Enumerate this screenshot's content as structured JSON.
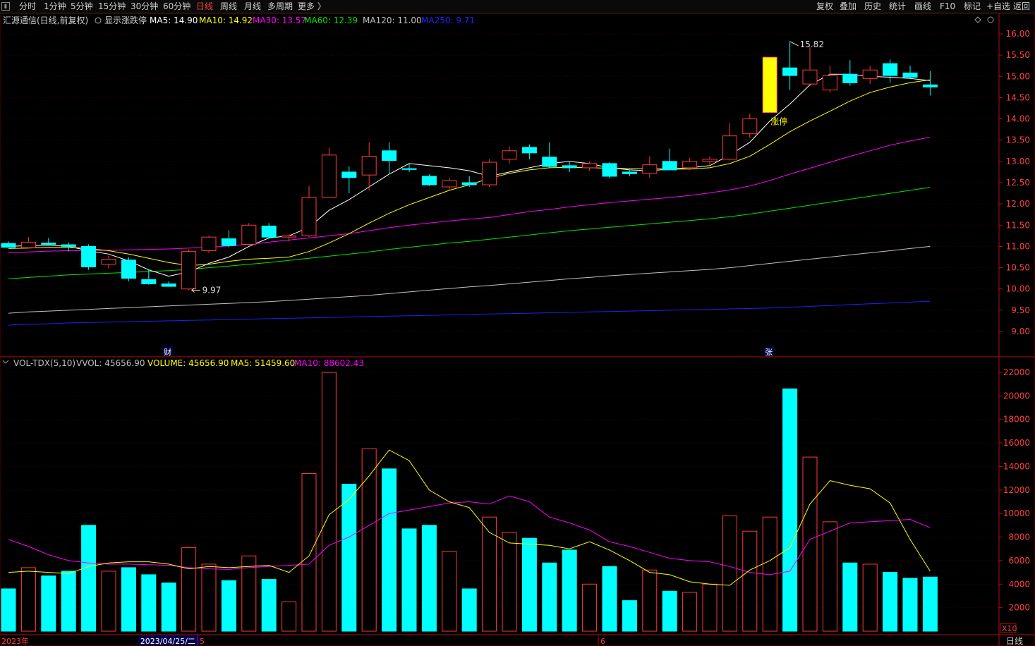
{
  "toolbar": {
    "left": [
      "分时",
      "1分钟",
      "5分钟",
      "15分钟",
      "30分钟",
      "60分钟",
      "日线",
      "周线",
      "月线",
      "多周期",
      "更多 〉"
    ],
    "active": "日线",
    "right": [
      "复权",
      "叠加",
      "历史",
      "统计",
      "画线",
      "F10",
      "标记",
      "+自选",
      "返回"
    ]
  },
  "price_header": {
    "title": "汇源通信(日线,前复权)",
    "toggle": "显示涨跌停",
    "items": [
      {
        "label": "MA5: 14.90",
        "color": "#ffffff"
      },
      {
        "label": "MA10: 14.92",
        "color": "#ffff00"
      },
      {
        "label": "MA30: 13.57",
        "color": "#ff00ff"
      },
      {
        "label": "MA60: 12.39",
        "color": "#00e600"
      },
      {
        "label": "MA120: 11.00",
        "color": "#c0c0c0"
      },
      {
        "label": "MA250: 9.71",
        "color": "#2020ff"
      }
    ]
  },
  "vol_header": {
    "items": [
      {
        "label": "VOL-TDX(5,10)",
        "color": "#c0c0c0"
      },
      {
        "label": "VVOL: 45656.90",
        "color": "#c0c0c0"
      },
      {
        "label": "VOLUME: 45656.90",
        "color": "#ffff00"
      },
      {
        "label": "MA5: 51459.60",
        "color": "#ffff00"
      },
      {
        "label": "MA10: 88602.43",
        "color": "#ff00ff"
      }
    ]
  },
  "chart_data": {
    "type": "candlestick",
    "price_axis": {
      "min": 8.8,
      "max": 16.25,
      "ticks": [
        "16.00",
        "15.50",
        "15.00",
        "14.50",
        "14.00",
        "13.50",
        "13.00",
        "12.50",
        "12.00",
        "11.50",
        "11.00",
        "10.50",
        "10.00",
        "9.50",
        "9.00"
      ]
    },
    "volume_axis": {
      "min": 0,
      "max": 22500,
      "ticks": [
        "22000",
        "20000",
        "18000",
        "16000",
        "14000",
        "12000",
        "10000",
        "8000",
        "6000",
        "4000",
        "2000"
      ],
      "unit": "X10"
    },
    "candles": [
      {
        "o": 11.07,
        "h": 11.12,
        "l": 10.98,
        "c": 10.98,
        "v": 3600
      },
      {
        "o": 10.97,
        "h": 11.22,
        "l": 10.95,
        "c": 11.1,
        "v": 5400
      },
      {
        "o": 11.08,
        "h": 11.2,
        "l": 11.02,
        "c": 11.05,
        "v": 4700
      },
      {
        "o": 11.04,
        "h": 11.1,
        "l": 10.88,
        "c": 11.0,
        "v": 5100
      },
      {
        "o": 11.0,
        "h": 11.05,
        "l": 10.45,
        "c": 10.52,
        "v": 9000
      },
      {
        "o": 10.58,
        "h": 10.78,
        "l": 10.48,
        "c": 10.7,
        "v": 5100
      },
      {
        "o": 10.68,
        "h": 10.75,
        "l": 10.18,
        "c": 10.25,
        "v": 5400
      },
      {
        "o": 10.22,
        "h": 10.45,
        "l": 10.1,
        "c": 10.12,
        "v": 4800
      },
      {
        "o": 10.12,
        "h": 10.18,
        "l": 10.06,
        "c": 10.06,
        "v": 4100
      },
      {
        "o": 10.0,
        "h": 10.93,
        "l": 9.97,
        "c": 10.88,
        "v": 7100
      },
      {
        "o": 10.9,
        "h": 11.25,
        "l": 10.85,
        "c": 11.22,
        "v": 5700
      },
      {
        "o": 11.18,
        "h": 11.38,
        "l": 10.98,
        "c": 11.02,
        "v": 4300
      },
      {
        "o": 11.05,
        "h": 11.55,
        "l": 11.03,
        "c": 11.5,
        "v": 6400
      },
      {
        "o": 11.48,
        "h": 11.55,
        "l": 11.18,
        "c": 11.22,
        "v": 4400
      },
      {
        "o": 11.22,
        "h": 11.28,
        "l": 11.12,
        "c": 11.25,
        "v": 2500
      },
      {
        "o": 11.25,
        "h": 12.42,
        "l": 11.22,
        "c": 12.15,
        "v": 13400
      },
      {
        "o": 12.15,
        "h": 13.32,
        "l": 12.15,
        "c": 13.15,
        "v": 22000
      },
      {
        "o": 12.75,
        "h": 12.88,
        "l": 12.25,
        "c": 12.62,
        "v": 12500
      },
      {
        "o": 12.68,
        "h": 13.45,
        "l": 12.32,
        "c": 13.12,
        "v": 15500
      },
      {
        "o": 13.25,
        "h": 13.45,
        "l": 12.72,
        "c": 13.02,
        "v": 13800
      },
      {
        "o": 12.83,
        "h": 12.95,
        "l": 12.75,
        "c": 12.81,
        "v": 8700
      },
      {
        "o": 12.65,
        "h": 12.7,
        "l": 12.42,
        "c": 12.45,
        "v": 9000
      },
      {
        "o": 12.4,
        "h": 12.62,
        "l": 12.32,
        "c": 12.55,
        "v": 6800
      },
      {
        "o": 12.5,
        "h": 12.65,
        "l": 12.4,
        "c": 12.45,
        "v": 3600
      },
      {
        "o": 12.45,
        "h": 13.05,
        "l": 12.4,
        "c": 12.98,
        "v": 9700
      },
      {
        "o": 13.05,
        "h": 13.35,
        "l": 12.95,
        "c": 13.25,
        "v": 8400
      },
      {
        "o": 13.33,
        "h": 13.4,
        "l": 13.05,
        "c": 13.2,
        "v": 7900
      },
      {
        "o": 13.1,
        "h": 13.45,
        "l": 12.85,
        "c": 12.88,
        "v": 5800
      },
      {
        "o": 12.9,
        "h": 12.98,
        "l": 12.75,
        "c": 12.85,
        "v": 6900
      },
      {
        "o": 12.85,
        "h": 13.0,
        "l": 12.78,
        "c": 12.95,
        "v": 4000
      },
      {
        "o": 12.95,
        "h": 12.98,
        "l": 12.6,
        "c": 12.65,
        "v": 5500
      },
      {
        "o": 12.75,
        "h": 12.8,
        "l": 12.65,
        "c": 12.71,
        "v": 2600
      },
      {
        "o": 12.72,
        "h": 13.12,
        "l": 12.62,
        "c": 12.92,
        "v": 5200
      },
      {
        "o": 13.0,
        "h": 13.3,
        "l": 12.8,
        "c": 12.8,
        "v": 3400
      },
      {
        "o": 12.85,
        "h": 13.08,
        "l": 12.8,
        "c": 13.0,
        "v": 3300
      },
      {
        "o": 13.0,
        "h": 13.12,
        "l": 12.92,
        "c": 13.05,
        "v": 4000
      },
      {
        "o": 13.05,
        "h": 13.9,
        "l": 13.02,
        "c": 13.6,
        "v": 9800
      },
      {
        "o": 13.65,
        "h": 14.12,
        "l": 13.55,
        "c": 14.0,
        "v": 8500
      },
      {
        "o": 14.15,
        "h": 15.45,
        "l": 14.15,
        "c": 15.45,
        "v": 9700,
        "limit_up": true
      },
      {
        "o": 15.2,
        "h": 15.82,
        "l": 14.68,
        "c": 15.02,
        "v": 20600
      },
      {
        "o": 14.82,
        "h": 15.68,
        "l": 14.78,
        "c": 15.15,
        "v": 14800
      },
      {
        "o": 14.68,
        "h": 15.25,
        "l": 14.62,
        "c": 15.02,
        "v": 9300
      },
      {
        "o": 15.05,
        "h": 15.38,
        "l": 14.78,
        "c": 14.85,
        "v": 5800
      },
      {
        "o": 14.95,
        "h": 15.25,
        "l": 14.82,
        "c": 15.15,
        "v": 5700
      },
      {
        "o": 15.3,
        "h": 15.4,
        "l": 14.85,
        "c": 15.02,
        "v": 5000
      },
      {
        "o": 15.08,
        "h": 15.25,
        "l": 14.95,
        "c": 14.98,
        "v": 4500
      },
      {
        "o": 14.8,
        "h": 15.12,
        "l": 14.55,
        "c": 14.75,
        "v": 4600
      }
    ],
    "ma_lines": [
      {
        "name": "MA30",
        "color": "#ff00ff",
        "values": [
          10.85,
          10.87,
          10.89,
          10.9,
          10.9,
          10.91,
          10.92,
          10.93,
          10.94,
          10.96,
          10.98,
          11.01,
          11.05,
          11.1,
          11.15,
          11.2,
          11.25,
          11.3,
          11.37,
          11.44,
          11.5,
          11.55,
          11.6,
          11.64,
          11.68,
          11.75,
          11.82,
          11.87,
          11.93,
          11.98,
          12.03,
          12.07,
          12.11,
          12.15,
          12.2,
          12.26,
          12.33,
          12.42,
          12.55,
          12.7,
          12.84,
          12.98,
          13.12,
          13.25,
          13.38,
          13.48,
          13.57
        ]
      },
      {
        "name": "MA60",
        "color": "#00e600",
        "values": [
          10.24,
          10.27,
          10.3,
          10.33,
          10.35,
          10.37,
          10.39,
          10.41,
          10.43,
          10.46,
          10.5,
          10.54,
          10.58,
          10.62,
          10.67,
          10.72,
          10.77,
          10.82,
          10.87,
          10.93,
          10.98,
          11.03,
          11.08,
          11.12,
          11.17,
          11.22,
          11.27,
          11.32,
          11.37,
          11.41,
          11.45,
          11.49,
          11.53,
          11.57,
          11.61,
          11.65,
          11.7,
          11.76,
          11.83,
          11.9,
          11.97,
          12.04,
          12.11,
          12.18,
          12.25,
          12.32,
          12.39
        ]
      },
      {
        "name": "MA120",
        "color": "#c0c0c0",
        "values": [
          9.43,
          9.46,
          9.48,
          9.5,
          9.52,
          9.54,
          9.56,
          9.58,
          9.6,
          9.62,
          9.64,
          9.66,
          9.68,
          9.7,
          9.73,
          9.76,
          9.79,
          9.82,
          9.85,
          9.89,
          9.93,
          9.97,
          10.01,
          10.05,
          10.08,
          10.12,
          10.16,
          10.2,
          10.24,
          10.27,
          10.31,
          10.34,
          10.37,
          10.4,
          10.43,
          10.46,
          10.5,
          10.55,
          10.6,
          10.65,
          10.7,
          10.75,
          10.8,
          10.85,
          10.9,
          10.95,
          11.0
        ]
      },
      {
        "name": "MA250",
        "color": "#2020ff",
        "values": [
          9.15,
          9.17,
          9.18,
          9.2,
          9.21,
          9.22,
          9.23,
          9.24,
          9.25,
          9.26,
          9.27,
          9.28,
          9.29,
          9.3,
          9.31,
          9.32,
          9.33,
          9.34,
          9.35,
          9.36,
          9.37,
          9.38,
          9.39,
          9.4,
          9.41,
          9.42,
          9.43,
          9.44,
          9.45,
          9.46,
          9.47,
          9.48,
          9.49,
          9.5,
          9.51,
          9.52,
          9.53,
          9.54,
          9.55,
          9.57,
          9.59,
          9.61,
          9.63,
          9.65,
          9.67,
          9.69,
          9.71
        ]
      },
      {
        "name": "MA10",
        "color": "#ffff00",
        "values": [
          10.95,
          10.96,
          10.98,
          10.98,
          10.95,
          10.9,
          10.82,
          10.72,
          10.62,
          10.55,
          10.58,
          10.65,
          10.7,
          10.72,
          10.75,
          10.88,
          11.08,
          11.3,
          11.55,
          11.78,
          11.98,
          12.15,
          12.32,
          12.45,
          12.6,
          12.72,
          12.8,
          12.85,
          12.86,
          12.85,
          12.84,
          12.83,
          12.83,
          12.82,
          12.82,
          12.85,
          12.95,
          13.12,
          13.4,
          13.7,
          13.95,
          14.18,
          14.42,
          14.62,
          14.75,
          14.85,
          14.92
        ]
      },
      {
        "name": "MA5",
        "color": "#ffffff",
        "values": [
          11.0,
          11.02,
          11.03,
          11.0,
          10.9,
          10.82,
          10.66,
          10.45,
          10.3,
          10.4,
          10.6,
          10.75,
          11.0,
          11.2,
          11.25,
          11.45,
          11.85,
          12.1,
          12.4,
          12.7,
          12.95,
          12.9,
          12.85,
          12.78,
          12.65,
          12.75,
          12.85,
          12.95,
          13.0,
          12.95,
          12.85,
          12.8,
          12.78,
          12.82,
          12.85,
          12.9,
          13.15,
          13.45,
          13.95,
          14.35,
          14.8,
          15.05,
          15.05,
          15.0,
          14.98,
          14.95,
          14.9
        ]
      }
    ],
    "vol_ma5": [
      5000,
      5100,
      5000,
      4900,
      5500,
      5800,
      5900,
      5900,
      5700,
      5300,
      5500,
      5400,
      5500,
      5600,
      5000,
      6400,
      9900,
      11200,
      13200,
      15400,
      14500,
      12000,
      11000,
      10500,
      8400,
      7500,
      7400,
      7300,
      7000,
      7600,
      6900,
      6000,
      5000,
      4800,
      4200,
      4000,
      3900,
      5200,
      6000,
      7100,
      10800,
      12800,
      12400,
      12100,
      10900,
      7800,
      5100
    ],
    "vol_ma10": [
      7800,
      7200,
      6500,
      6000,
      5800,
      5700,
      5700,
      5650,
      5600,
      5400,
      5300,
      5250,
      5400,
      5500,
      5600,
      5700,
      7300,
      8000,
      9000,
      10000,
      10300,
      10600,
      10900,
      11000,
      10800,
      11500,
      11000,
      9700,
      9200,
      8600,
      7600,
      7200,
      6700,
      6200,
      6000,
      5900,
      5500,
      5000,
      4800,
      5100,
      7800,
      8500,
      9200,
      9300,
      9400,
      9500,
      8800
    ],
    "annotations": [
      {
        "text": "15.82",
        "kind": "high",
        "index": 39
      },
      {
        "text": "9.97",
        "kind": "low",
        "index": 9
      },
      {
        "text": "涨停",
        "kind": "limit",
        "index": 38
      }
    ],
    "event_markers": [
      {
        "text": "财",
        "index": 8
      },
      {
        "text": "张",
        "index": 38
      }
    ],
    "x_labels": [
      {
        "text": "2023年",
        "index": 0
      },
      {
        "text": "2023/04/25/二",
        "index": 7,
        "highlight": true
      },
      {
        "text": "5",
        "index": 10
      },
      {
        "text": "6",
        "index": 30
      }
    ],
    "period_label": "日线"
  },
  "colors": {
    "up": "#ff3a3a",
    "down": "#00ffff",
    "limit": "#ffff00",
    "axis": "#b01010",
    "text": "#c0c0c0",
    "axis_text": "#ff4040"
  }
}
